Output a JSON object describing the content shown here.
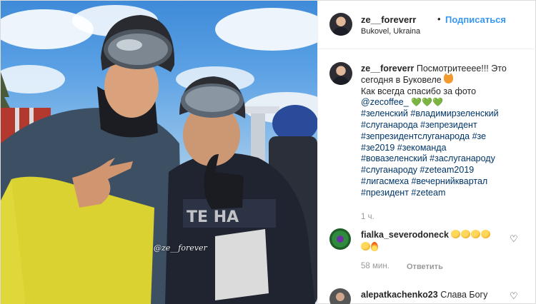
{
  "post": {
    "author": {
      "username": "ze__foreverr",
      "follow_label": "Подписаться",
      "separator": "•",
      "location": "Bukovel, Ukraina"
    },
    "photo": {
      "watermark": "@ze__forever"
    },
    "caption": {
      "username": "ze__foreverr",
      "line1": "Посмотритееее!!! Это сегодня в Буковеле",
      "line2": "Как всегда спасибо за фото",
      "mention": "@zecoffee_",
      "hearts": "💚💚💚",
      "hashtags": [
        "#зеленский #владимирзеленский",
        "#слуганарода #зепрезидент",
        "#зепрезидентслуганарода #зе",
        "#зе2019 #зекоманда",
        "#вовазеленский #заслуганароду",
        "#слуганароду #zeteam2019",
        "#лигасмеха #вечернийквартал",
        "#президент #zeteam"
      ],
      "time": "1 ч."
    },
    "comments": [
      {
        "username": "fialka_severodoneck",
        "text": "",
        "time": "58 мин.",
        "reply_label": "Ответить",
        "heart_icon": "heart-outline-icon"
      },
      {
        "username": "alepatkachenko23",
        "text": "Слава Богу",
        "heart_icon": "heart-outline-icon"
      }
    ]
  }
}
